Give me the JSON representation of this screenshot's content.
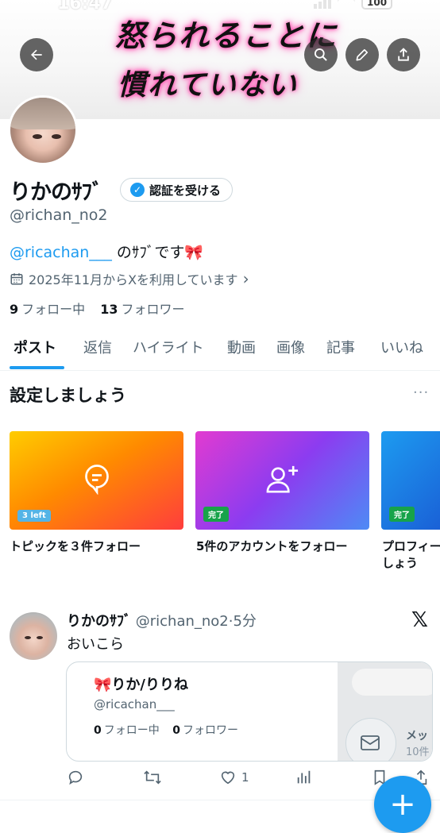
{
  "status_bar": {
    "time": "16:47",
    "battery": "100"
  },
  "banner": {
    "line1": "怒られることに",
    "line2": "慣れていない"
  },
  "profile": {
    "name": "りかのｻﾌﾞ",
    "verify_label": "認証を受ける",
    "handle": "@richan_no2",
    "bio_mention": "@ricachan___",
    "bio_rest": " のｻﾌﾞです🎀",
    "joined": "2025年11月からXを利用しています",
    "following_count": "9",
    "following_label": "フォロー中",
    "followers_count": "13",
    "followers_label": "フォロワー"
  },
  "tabs": [
    "ポスト",
    "返信",
    "ハイライト",
    "動画",
    "画像",
    "記事",
    "いいね"
  ],
  "setup": {
    "title": "設定しましょう",
    "more": "···",
    "cards": [
      {
        "tag": "3 left",
        "label": "トピックを３件フォロー",
        "icon": "chat-bubble-icon"
      },
      {
        "tag": "完了",
        "label": "5件のアカウントをフォロー",
        "icon": "add-person-icon"
      },
      {
        "tag": "完了",
        "label": "プロフィー\nしょう",
        "icon": "profile-icon"
      }
    ]
  },
  "tweet": {
    "name": "りかのｻﾌﾞ",
    "handle_time": "@richan_no2·5分",
    "text": "おいこら",
    "embed": {
      "name": "🎀りか/りりね",
      "handle": "@ricachan___",
      "following_count": "0",
      "following_label": "フォロー中",
      "followers_count": "0",
      "followers_label": "フォロワー",
      "message_label": "メッ",
      "message_count": "10件"
    },
    "likes": "1"
  },
  "colors": {
    "accent": "#1d9bf0",
    "text": "#0f1419",
    "muted": "#536471"
  }
}
